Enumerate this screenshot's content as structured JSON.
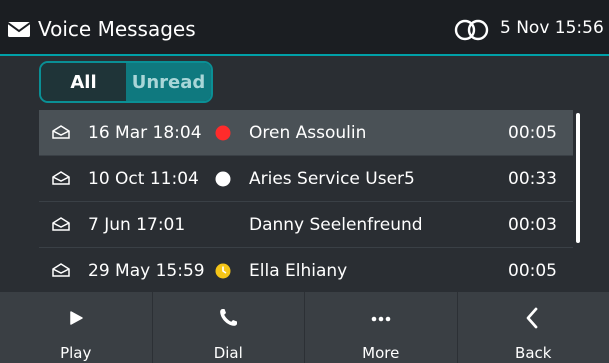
{
  "header": {
    "title": "Voice Messages",
    "datetime": "5 Nov 15:56"
  },
  "tabs": [
    {
      "label": "All",
      "selected": false
    },
    {
      "label": "Unread",
      "selected": true
    }
  ],
  "messages": [
    {
      "date": "16 Mar 18:04",
      "status": "red",
      "name": "Oren Assoulin",
      "duration": "00:05",
      "selected": true
    },
    {
      "date": "10 Oct 11:04",
      "status": "white",
      "name": "Aries Service User5",
      "duration": "00:33",
      "selected": false
    },
    {
      "date": "7 Jun 17:01",
      "status": "none",
      "name": "Danny Seelenfreund",
      "duration": "00:03",
      "selected": false
    },
    {
      "date": "29 May 15:59",
      "status": "yellow-clock",
      "name": "Ella Elhiany",
      "duration": "00:05",
      "selected": false
    }
  ],
  "softkeys": [
    {
      "label": "Play",
      "icon": "play-icon"
    },
    {
      "label": "Dial",
      "icon": "phone-icon"
    },
    {
      "label": "More",
      "icon": "more-icon"
    },
    {
      "label": "Back",
      "icon": "back-icon"
    }
  ],
  "colors": {
    "accent": "#00a0a8",
    "red": "#ff2b2b",
    "yellow": "#f5c518"
  }
}
